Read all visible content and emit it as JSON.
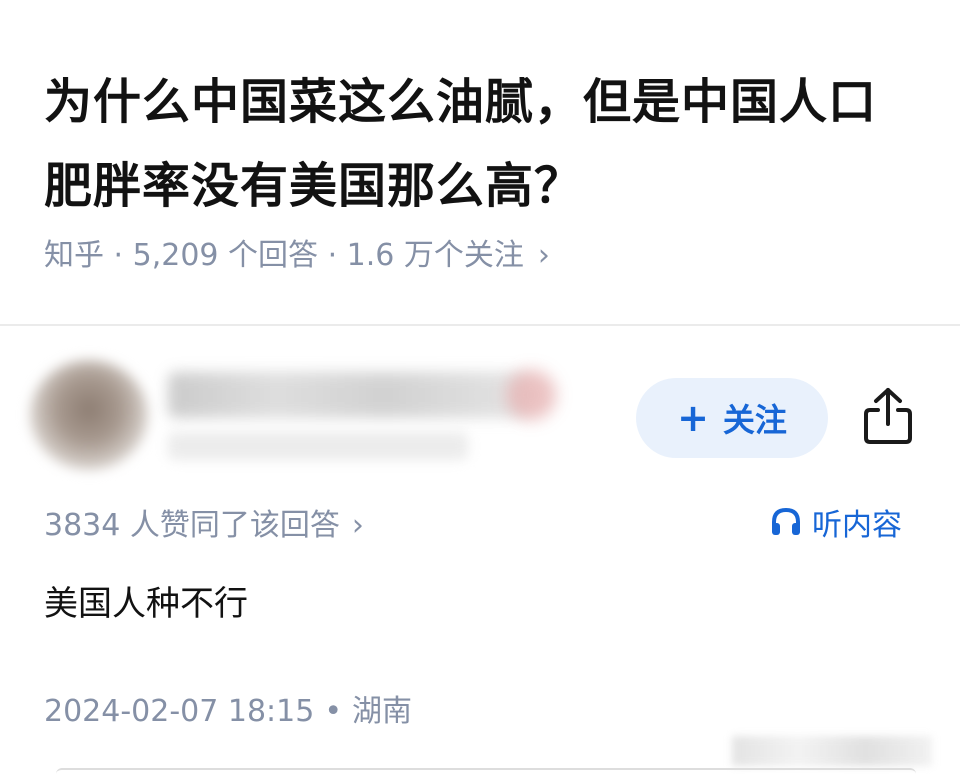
{
  "question": {
    "title": "为什么中国菜这么油腻，但是中国人口肥胖率没有美国那么高？",
    "meta": "知乎 · 5,209 个回答 · 1.6 万个关注",
    "meta_chevron": "›"
  },
  "author": {
    "follow_label": "关注",
    "follow_plus": "+"
  },
  "answer": {
    "upvote_text": "3834 人赞同了该回答",
    "upvote_chevron": "›",
    "listen_label": "听内容",
    "content": "美国人种不行",
    "date": "2024-02-07 18:15",
    "separator": "•",
    "location": "湖南"
  },
  "colors": {
    "accent": "#1766d6",
    "accent_bg": "#e9f1fc",
    "meta_gray": "#8590a6",
    "title": "#121212"
  },
  "icons": {
    "share": "share-icon",
    "headphones": "headphones-icon",
    "plus": "plus-icon"
  }
}
